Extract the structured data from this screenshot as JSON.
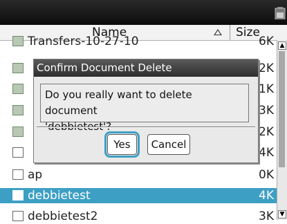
{
  "header": {
    "name_label": "Name",
    "size_label": "Size"
  },
  "files": [
    {
      "name": "Transfers-10-27-10",
      "size": "6K",
      "type": "folder",
      "selected": false
    },
    {
      "name": "",
      "size": "2K",
      "type": "folder",
      "selected": false
    },
    {
      "name": "",
      "size": "1K",
      "type": "folder",
      "selected": false
    },
    {
      "name": "",
      "size": "3K",
      "type": "folder",
      "selected": false
    },
    {
      "name": "",
      "size": "2K",
      "type": "folder",
      "selected": false
    },
    {
      "name": "",
      "size": "4K",
      "type": "document",
      "selected": false
    },
    {
      "name": "ap",
      "size": "0K",
      "type": "document",
      "selected": false
    },
    {
      "name": "debbietest",
      "size": "4K",
      "type": "document",
      "selected": true
    },
    {
      "name": "debbietest2",
      "size": "3K",
      "type": "document",
      "selected": false
    }
  ],
  "dialog": {
    "title": "Confirm Document Delete",
    "message_line1": "Do you really want to delete document",
    "message_line2": "'debbietest'?",
    "yes_label": "Yes",
    "cancel_label": "Cancel"
  },
  "colors": {
    "selection": "#3d9fc4",
    "titlebar": "#1a1a1a"
  },
  "icons": {
    "battery": "battery-icon",
    "folder": "folder-icon",
    "document": "document-icon"
  }
}
